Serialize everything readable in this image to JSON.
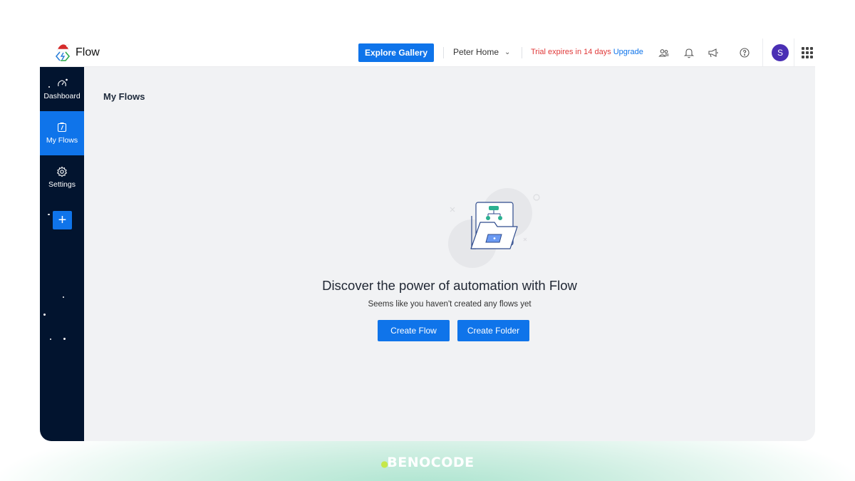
{
  "app": {
    "name": "Flow",
    "logo_icon": "flow-logo-with-santa-hat"
  },
  "topbar": {
    "explore_label": "Explore Gallery",
    "workspace": "Peter Home",
    "workspace_icon": "chevron-down-icon",
    "trial_text": "Trial expires in 14 days",
    "upgrade_label": "Upgrade",
    "icons": [
      "contacts-icon",
      "bell-icon",
      "megaphone-icon",
      "help-icon",
      "apps-grid-icon"
    ],
    "avatar_initial": "S",
    "colors": {
      "primary": "#0f74ea",
      "trial": "#e03a3a",
      "avatar": "#4a2fb4"
    }
  },
  "sidebar": {
    "items": [
      {
        "label": "Dashboard",
        "icon": "speedometer-icon",
        "active": false
      },
      {
        "label": "My Flows",
        "icon": "flow-icon",
        "active": true
      },
      {
        "label": "Settings",
        "icon": "gear-icon",
        "active": false
      }
    ],
    "add_icon": "plus-icon",
    "bg_color": "#02142f"
  },
  "main": {
    "title": "My Flows",
    "empty_state": {
      "illustration": "folder-with-flowchart",
      "heading": "Discover the power of automation with Flow",
      "subtext": "Seems like you haven't created any flows yet",
      "create_flow_label": "Create Flow",
      "create_folder_label": "Create Folder"
    }
  },
  "watermark": {
    "text": "BENOCODE"
  }
}
